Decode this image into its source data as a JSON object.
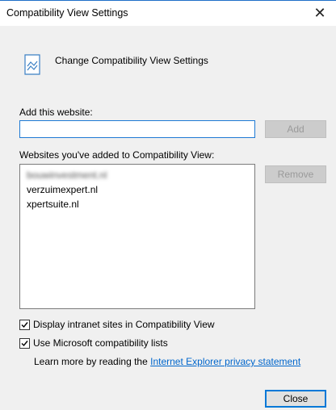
{
  "window": {
    "title": "Compatibility View Settings"
  },
  "header": {
    "text": "Change Compatibility View Settings",
    "icon": "compatibility-view-icon"
  },
  "add_section": {
    "label": "Add this website:",
    "input_value": "",
    "add_button": "Add"
  },
  "websites": {
    "label": "Websites you've added to Compatibility View:",
    "items": [
      "bouwinvestment.nl",
      "verzuimexpert.nl",
      "xpertsuite.nl"
    ],
    "remove_button": "Remove"
  },
  "options": {
    "intranet": {
      "label": "Display intranet sites in Compatibility View",
      "checked": true
    },
    "ms_lists": {
      "label": "Use Microsoft compatibility lists",
      "checked": true
    }
  },
  "learn_more": {
    "prefix": "Learn more by reading the",
    "link": "Internet Explorer privacy statement"
  },
  "close_button": "Close"
}
